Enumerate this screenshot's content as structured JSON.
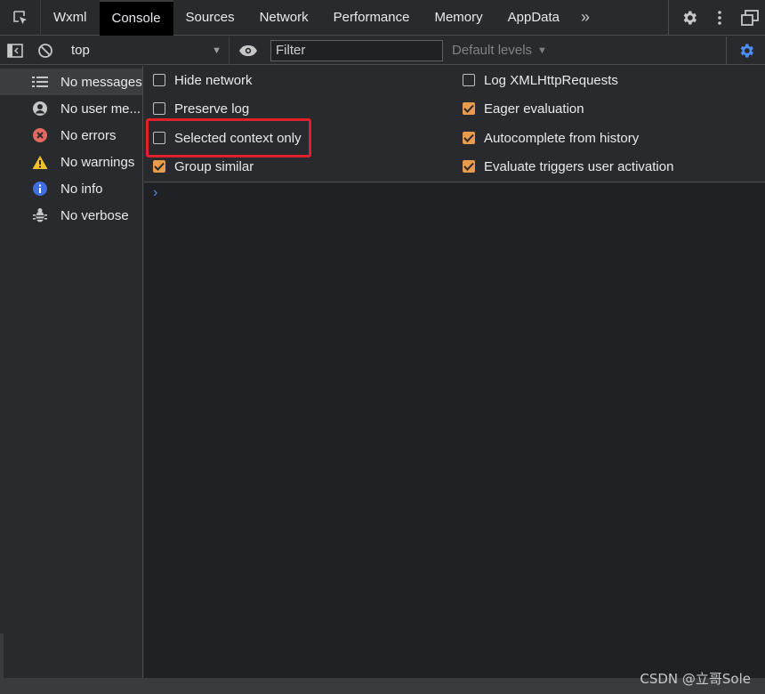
{
  "tabs": [
    {
      "label": "Wxml",
      "active": false
    },
    {
      "label": "Console",
      "active": true
    },
    {
      "label": "Sources",
      "active": false
    },
    {
      "label": "Network",
      "active": false
    },
    {
      "label": "Performance",
      "active": false
    },
    {
      "label": "Memory",
      "active": false
    },
    {
      "label": "AppData",
      "active": false
    }
  ],
  "tabbar": {
    "more_label": "»"
  },
  "toolbar": {
    "context_value": "top",
    "filter_placeholder": "Filter",
    "levels_label": "Default levels"
  },
  "sidebar": {
    "items": [
      {
        "label": "No messages",
        "icon": "list-icon"
      },
      {
        "label": "No user me...",
        "icon": "user-icon"
      },
      {
        "label": "No errors",
        "icon": "error-icon"
      },
      {
        "label": "No warnings",
        "icon": "warning-icon"
      },
      {
        "label": "No info",
        "icon": "info-icon"
      },
      {
        "label": "No verbose",
        "icon": "bug-icon"
      }
    ]
  },
  "settings": {
    "left": [
      {
        "label": "Hide network",
        "checked": false
      },
      {
        "label": "Preserve log",
        "checked": false
      },
      {
        "label": "Selected context only",
        "checked": false
      },
      {
        "label": "Group similar",
        "checked": true
      }
    ],
    "right": [
      {
        "label": "Log XMLHttpRequests",
        "checked": false
      },
      {
        "label": "Eager evaluation",
        "checked": true
      },
      {
        "label": "Autocomplete from history",
        "checked": true
      },
      {
        "label": "Evaluate triggers user activation",
        "checked": true
      }
    ]
  },
  "console": {
    "prompt": "›"
  },
  "watermark": "CSDN @立哥Sole",
  "colors": {
    "accent": "#e69c4c",
    "highlight": "#e0202a",
    "link": "#4c8ef7"
  }
}
